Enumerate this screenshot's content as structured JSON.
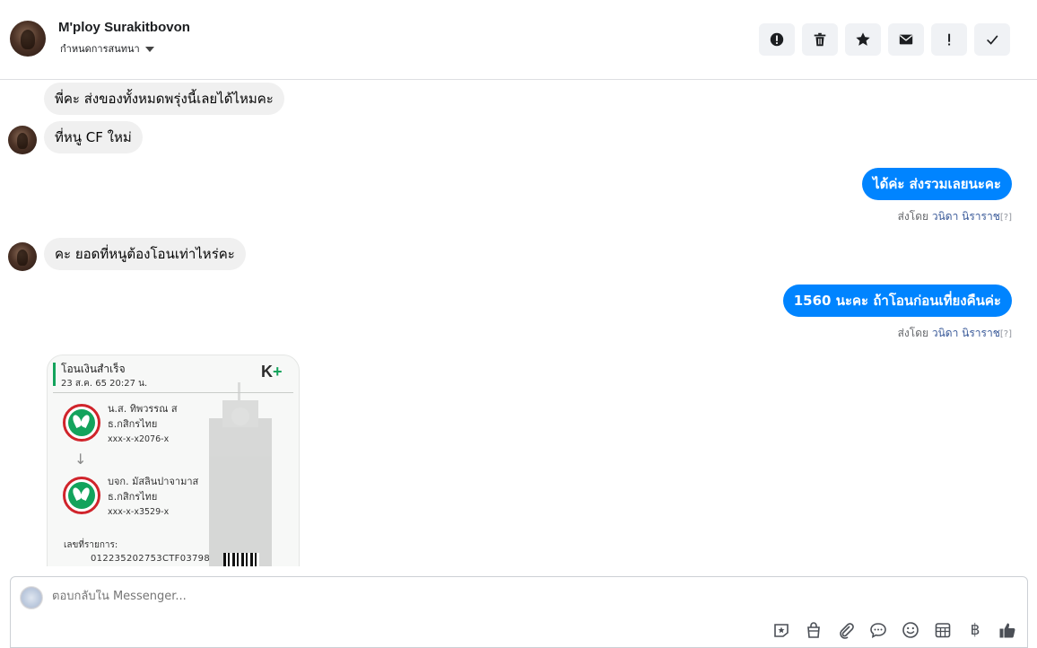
{
  "header": {
    "contact_name": "M'ploy Surakitbovon",
    "conversation_setting": "กำหนดการสนทนา",
    "actions": [
      {
        "name": "report",
        "icon": "exclamation-circle-icon"
      },
      {
        "name": "delete",
        "icon": "trash-icon"
      },
      {
        "name": "star",
        "icon": "star-icon"
      },
      {
        "name": "mark-unread",
        "icon": "envelope-icon"
      },
      {
        "name": "important",
        "icon": "exclamation-icon"
      },
      {
        "name": "done",
        "icon": "check-icon"
      }
    ]
  },
  "messages": [
    {
      "direction": "in",
      "text": "พี่คะ ส่งของทั้งหมดพรุ่งนี้เลยได้ไหมคะ"
    },
    {
      "direction": "in",
      "text": "ที่หนู CF ใหม่"
    },
    {
      "direction": "out",
      "text": "ได้ค่ะ ส่งรวมเลยนะคะ",
      "sent_by_label": "ส่งโดย",
      "sender": "วนิดา นิราราช",
      "hint": "[?]"
    },
    {
      "direction": "in",
      "text": "คะ ยอดที่หนูต้องโอนเท่าไหร่คะ"
    },
    {
      "direction": "out",
      "text": "1560 นะคะ ถ้าโอนก่อนเที่ยงคืนค่ะ",
      "sent_by_label": "ส่งโดย",
      "sender": "วนิดา นิราราช",
      "hint": "[?]"
    }
  ],
  "slip": {
    "title": "โอนเงินสำเร็จ",
    "date": "23 ส.ค. 65  20:27 น.",
    "logo": "K",
    "logo_plus": "+",
    "from_name": "น.ส. ทิพวรรณ ส",
    "from_bank": "ธ.กสิกรไทย",
    "from_account": "xxx-x-x2076-x",
    "to_name": "บจก. มัสลินปาจามาส",
    "to_bank": "ธ.กสิกรไทย",
    "to_account": "xxx-x-x3529-x",
    "ref_label": "เลขที่รายการ:",
    "ref_number": "012235202753CTF03798"
  },
  "composer": {
    "placeholder": "ตอบกลับใน Messenger...",
    "tools": [
      "sticker-icon",
      "shop-bag-icon",
      "attachment-icon",
      "saved-reply-icon",
      "emoji-icon",
      "appointment-icon",
      "baht-icon",
      "like-icon"
    ],
    "baht_symbol": "฿"
  }
}
